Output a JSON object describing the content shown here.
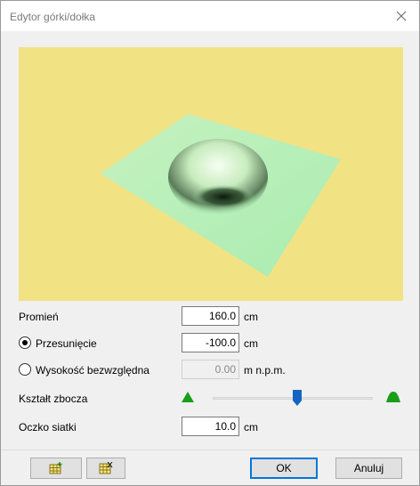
{
  "window": {
    "title": "Edytor górki/dołka"
  },
  "icons": {
    "close": "close-icon",
    "grid_add": "grid-add-icon",
    "grid_remove": "grid-remove-icon"
  },
  "colors": {
    "preview_bg": "#f1e284",
    "terrain": "#b9f0b4",
    "slider_thumb": "#1565c0",
    "shape_icon": "#1a9e1a"
  },
  "form": {
    "radius": {
      "label": "Promień",
      "value": "160.0",
      "unit": "cm"
    },
    "offset": {
      "label": "Przesunięcie",
      "value": "-100.0",
      "unit": "cm",
      "selected": true
    },
    "absolute_height": {
      "label": "Wysokość bezwzględna",
      "value": "0.00",
      "unit": "m n.p.m.",
      "selected": false
    },
    "slope_shape": {
      "label": "Kształt zbocza",
      "level": 0.53
    },
    "mesh": {
      "label": "Oczko siatki",
      "value": "10.0",
      "unit": "cm"
    }
  },
  "buttons": {
    "ok": "OK",
    "cancel": "Anuluj"
  }
}
